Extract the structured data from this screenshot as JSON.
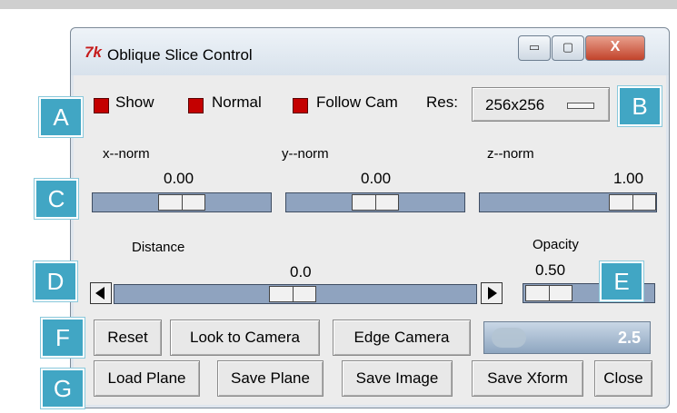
{
  "window": {
    "title": "Oblique Slice Control",
    "icon_text": "7k",
    "controls": {
      "minimize": "▭",
      "maximize": "▢",
      "close": "X"
    }
  },
  "toggles": [
    {
      "label": "Show",
      "checked": true
    },
    {
      "label": "Normal",
      "checked": true
    },
    {
      "label": "Follow Cam",
      "checked": true
    }
  ],
  "resolution": {
    "label": "Res:",
    "value": "256x256"
  },
  "sliders": {
    "x": {
      "label": "x--norm",
      "value": "0.00"
    },
    "y": {
      "label": "y--norm",
      "value": "0.00"
    },
    "z": {
      "label": "z--norm",
      "value": "1.00"
    },
    "distance": {
      "label": "Distance",
      "value": "0.0"
    },
    "opacity": {
      "label": "Opacity",
      "value": "0.50"
    }
  },
  "buttons_row1": [
    "Reset",
    "Look to Camera",
    "Edge Camera"
  ],
  "speed_control": {
    "value": "2.5"
  },
  "buttons_row2": [
    "Load Plane",
    "Save Plane",
    "Save Image",
    "Save Xform",
    "Close"
  ],
  "callouts": [
    "A",
    "B",
    "C",
    "D",
    "E",
    "F",
    "G"
  ],
  "colors": {
    "checkbox": "#c40000",
    "trough": "#8fa3bf",
    "callout": "#41a6c4"
  }
}
